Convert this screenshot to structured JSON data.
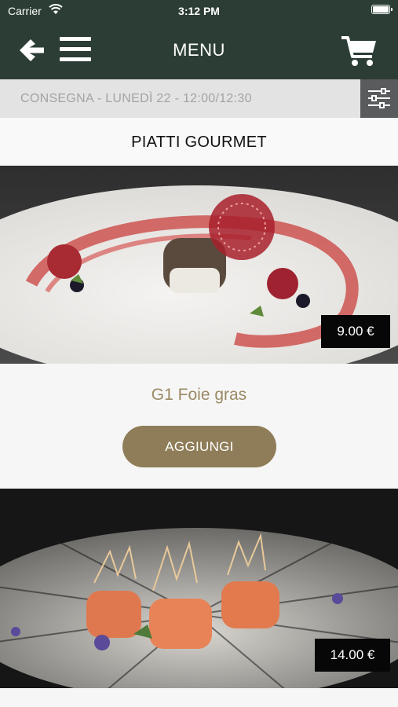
{
  "status_bar": {
    "carrier": "Carrier",
    "time": "3:12 PM"
  },
  "nav": {
    "title": "MENU",
    "icons": [
      "back-arrow-icon",
      "hamburger-menu-icon",
      "cart-icon"
    ]
  },
  "delivery": {
    "label": "CONSEGNA - LUNEDÌ 22 - 12:00/12:30",
    "filter_icon": "sliders-icon"
  },
  "section": {
    "title": "PIATTI GOURMET"
  },
  "products": [
    {
      "name": "G1 Foie gras",
      "price": "9.00 €",
      "add_label": "AGGIUNGI",
      "image": "foie-gras-plate-photo"
    },
    {
      "name": "",
      "price": "14.00 €",
      "image": "salmon-rolls-plate-photo"
    }
  ],
  "colors": {
    "header": "#2c3d35",
    "delivery_bg": "#e3e3e3",
    "filter_bg": "#595b5c",
    "accent": "#8e7d58",
    "product_name": "#9a8a65"
  }
}
